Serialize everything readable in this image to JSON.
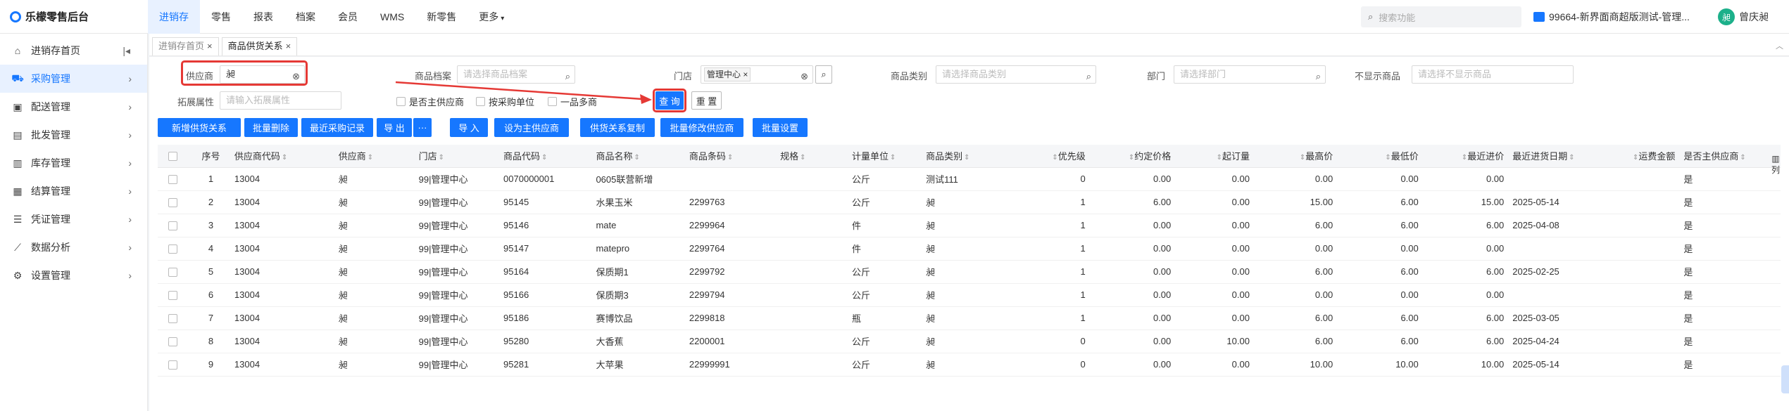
{
  "app": {
    "title": "乐檬零售后台"
  },
  "topnav": [
    "进销存",
    "零售",
    "报表",
    "档案",
    "会员",
    "WMS",
    "新零售",
    "更多"
  ],
  "search": {
    "placeholder": "搜索功能"
  },
  "store": {
    "label": "99664-新界面商超版测试-管理..."
  },
  "user": {
    "name": "曾庆昶",
    "avatar": "昶"
  },
  "sidebar": {
    "items": [
      {
        "label": "进销存首页",
        "icon": "home-icon"
      },
      {
        "label": "采购管理",
        "icon": "cart-icon"
      },
      {
        "label": "配送管理",
        "icon": "delivery-icon"
      },
      {
        "label": "批发管理",
        "icon": "wholesale-icon"
      },
      {
        "label": "库存管理",
        "icon": "inventory-icon"
      },
      {
        "label": "结算管理",
        "icon": "settlement-icon"
      },
      {
        "label": "凭证管理",
        "icon": "voucher-icon"
      },
      {
        "label": "数据分析",
        "icon": "chart-icon"
      },
      {
        "label": "设置管理",
        "icon": "settings-icon"
      }
    ]
  },
  "tabs": [
    {
      "label": "进销存首页"
    },
    {
      "label": "商品供货关系"
    }
  ],
  "filters": {
    "supplier_label": "供应商",
    "supplier_value": "昶",
    "product_label": "商品档案",
    "product_placeholder": "请选择商品档案",
    "store_label": "门店",
    "store_tag": "管理中心",
    "category_label": "商品类别",
    "category_placeholder": "请选择商品类别",
    "dept_label": "部门",
    "dept_placeholder": "请选择部门",
    "hide_label": "不显示商品",
    "hide_placeholder": "请选择不显示商品",
    "ext_label": "拓展属性",
    "ext_placeholder": "请输入拓展属性",
    "chk_main": "是否主供应商",
    "chk_unit": "按采购单位",
    "chk_multi": "一品多商",
    "query": "查 询",
    "reset": "重 置"
  },
  "actions": {
    "add": "新增供货关系",
    "batch_delete": "批量删除",
    "recent": "最近采购记录",
    "export": "导 出",
    "more": "···",
    "import": "导 入",
    "set_main": "设为主供应商",
    "copy": "供货关系复制",
    "batch_modify": "批量修改供应商",
    "batch_set": "批量设置"
  },
  "table": {
    "headers": [
      "序号",
      "供应商代码",
      "供应商",
      "门店",
      "商品代码",
      "商品名称",
      "商品条码",
      "规格",
      "计量单位",
      "商品类别",
      "优先级",
      "约定价格",
      "起订量",
      "最高价",
      "最低价",
      "最近进价",
      "最近进货日期",
      "运费金额",
      "是否主供应商"
    ],
    "rows": [
      [
        "1",
        "13004",
        "昶",
        "99|管理中心",
        "0070000001",
        "0605联营新增",
        "",
        "",
        "公斤",
        "测试111",
        "0",
        "0.00",
        "0.00",
        "0.00",
        "0.00",
        "0.00",
        "",
        "",
        "是"
      ],
      [
        "2",
        "13004",
        "昶",
        "99|管理中心",
        "95145",
        "水果玉米",
        "2299763",
        "",
        "公斤",
        "昶",
        "1",
        "6.00",
        "0.00",
        "15.00",
        "6.00",
        "15.00",
        "2025-05-14",
        "",
        "是"
      ],
      [
        "3",
        "13004",
        "昶",
        "99|管理中心",
        "95146",
        "mate",
        "2299964",
        "",
        "件",
        "昶",
        "1",
        "0.00",
        "0.00",
        "6.00",
        "6.00",
        "6.00",
        "2025-04-08",
        "",
        "是"
      ],
      [
        "4",
        "13004",
        "昶",
        "99|管理中心",
        "95147",
        "matepro",
        "2299764",
        "",
        "件",
        "昶",
        "1",
        "0.00",
        "0.00",
        "0.00",
        "0.00",
        "0.00",
        "",
        "",
        "是"
      ],
      [
        "5",
        "13004",
        "昶",
        "99|管理中心",
        "95164",
        "保质期1",
        "2299792",
        "",
        "公斤",
        "昶",
        "1",
        "0.00",
        "0.00",
        "6.00",
        "6.00",
        "6.00",
        "2025-02-25",
        "",
        "是"
      ],
      [
        "6",
        "13004",
        "昶",
        "99|管理中心",
        "95166",
        "保质期3",
        "2299794",
        "",
        "公斤",
        "昶",
        "1",
        "0.00",
        "0.00",
        "0.00",
        "0.00",
        "0.00",
        "",
        "",
        "是"
      ],
      [
        "7",
        "13004",
        "昶",
        "99|管理中心",
        "95186",
        "赛博饮品",
        "2299818",
        "",
        "瓶",
        "昶",
        "1",
        "0.00",
        "0.00",
        "6.00",
        "6.00",
        "6.00",
        "2025-03-05",
        "",
        "是"
      ],
      [
        "8",
        "13004",
        "昶",
        "99|管理中心",
        "95280",
        "大香蕉",
        "2200001",
        "",
        "公斤",
        "昶",
        "0",
        "0.00",
        "10.00",
        "6.00",
        "6.00",
        "6.00",
        "2025-04-24",
        "",
        "是"
      ],
      [
        "9",
        "13004",
        "昶",
        "99|管理中心",
        "95281",
        "大苹果",
        "22999991",
        "",
        "公斤",
        "昶",
        "0",
        "0.00",
        "0.00",
        "10.00",
        "10.00",
        "10.00",
        "2025-05-14",
        "",
        "是"
      ]
    ]
  },
  "column_tool": "列",
  "colors": {
    "accent": "#1677ff",
    "highlight": "#e53935"
  }
}
